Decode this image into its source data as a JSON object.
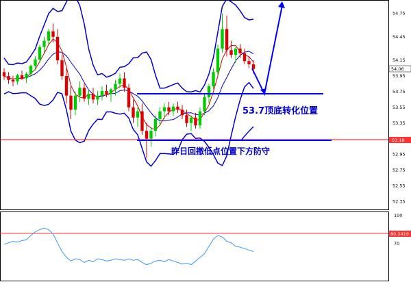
{
  "price_axis": {
    "ticks": [
      "54.75",
      "54.45",
      "54.15",
      "53.95",
      "53.75",
      "53.55",
      "53.35",
      "53.15",
      "52.95",
      "52.75",
      "52.55",
      "52.35"
    ],
    "current_label": "54.06",
    "level_label": "53.18",
    "ylim": [
      52.3,
      54.85
    ]
  },
  "indicator_axis": {
    "ticks": [
      "100",
      "70"
    ],
    "level_label": "80.2419",
    "ylim": [
      10,
      100
    ]
  },
  "annotations": {
    "level_text": "53.7顶底转化位置",
    "defense_text": "昨日回撤低点位置下方防守"
  },
  "colors": {
    "bull": "#00cc00",
    "bear": "#dd0000",
    "band": "#0000cc",
    "annotation": "#0000ff",
    "level_line": "#ff0000",
    "indicator": "#3399ff"
  },
  "chart_data": {
    "type": "candlestick",
    "series": {
      "ohlc": [
        [
          54.0,
          54.05,
          53.9,
          53.95
        ],
        [
          53.95,
          54.0,
          53.85,
          53.9
        ],
        [
          53.9,
          53.95,
          53.82,
          53.88
        ],
        [
          53.88,
          53.98,
          53.84,
          53.96
        ],
        [
          53.96,
          54.02,
          53.9,
          53.92
        ],
        [
          53.92,
          54.0,
          53.86,
          53.98
        ],
        [
          53.98,
          54.1,
          53.94,
          54.08
        ],
        [
          54.08,
          54.2,
          54.02,
          54.16
        ],
        [
          54.16,
          54.35,
          54.12,
          54.32
        ],
        [
          54.32,
          54.45,
          54.25,
          54.4
        ],
        [
          54.4,
          54.55,
          54.35,
          54.52
        ],
        [
          54.52,
          54.62,
          54.38,
          54.45
        ],
        [
          54.45,
          54.55,
          54.1,
          54.15
        ],
        [
          54.15,
          54.22,
          53.9,
          53.95
        ],
        [
          53.95,
          54.05,
          53.6,
          53.7
        ],
        [
          53.7,
          53.82,
          53.4,
          53.52
        ],
        [
          53.52,
          53.75,
          53.45,
          53.7
        ],
        [
          53.7,
          53.88,
          53.62,
          53.8
        ],
        [
          53.8,
          53.85,
          53.62,
          53.66
        ],
        [
          53.66,
          53.78,
          53.58,
          53.72
        ],
        [
          53.72,
          53.8,
          53.6,
          53.65
        ],
        [
          53.65,
          53.76,
          53.58,
          53.7
        ],
        [
          53.7,
          53.82,
          53.64,
          53.76
        ],
        [
          53.76,
          53.84,
          53.68,
          53.72
        ],
        [
          53.72,
          53.8,
          53.62,
          53.78
        ],
        [
          53.78,
          53.9,
          53.7,
          53.85
        ],
        [
          53.85,
          53.98,
          53.8,
          53.92
        ],
        [
          53.92,
          54.0,
          53.75,
          53.8
        ],
        [
          53.8,
          53.85,
          53.5,
          53.55
        ],
        [
          53.55,
          53.65,
          53.35,
          53.42
        ],
        [
          53.42,
          53.55,
          53.3,
          53.5
        ],
        [
          53.5,
          53.6,
          53.2,
          53.25
        ],
        [
          53.25,
          53.35,
          52.9,
          53.15
        ],
        [
          53.15,
          53.3,
          53.05,
          53.25
        ],
        [
          53.25,
          53.45,
          53.18,
          53.4
        ],
        [
          53.4,
          53.55,
          53.32,
          53.5
        ],
        [
          53.5,
          53.6,
          53.4,
          53.55
        ],
        [
          53.55,
          53.62,
          53.45,
          53.5
        ],
        [
          53.5,
          53.6,
          53.44,
          53.56
        ],
        [
          53.56,
          53.62,
          53.48,
          53.52
        ],
        [
          53.52,
          53.58,
          53.4,
          53.45
        ],
        [
          53.45,
          53.52,
          53.3,
          53.35
        ],
        [
          53.35,
          53.45,
          53.25,
          53.42
        ],
        [
          53.42,
          53.48,
          53.28,
          53.32
        ],
        [
          53.32,
          53.55,
          53.28,
          53.5
        ],
        [
          53.5,
          53.72,
          53.45,
          53.68
        ],
        [
          53.68,
          53.85,
          53.6,
          53.82
        ],
        [
          53.82,
          54.05,
          53.78,
          54.0
        ],
        [
          54.0,
          54.35,
          53.95,
          54.3
        ],
        [
          54.3,
          54.75,
          54.25,
          54.55
        ],
        [
          54.55,
          54.72,
          54.2,
          54.28
        ],
        [
          54.28,
          54.4,
          54.18,
          54.22
        ],
        [
          54.22,
          54.32,
          54.12,
          54.3
        ],
        [
          54.3,
          54.36,
          54.18,
          54.24
        ],
        [
          54.24,
          54.3,
          54.1,
          54.14
        ],
        [
          54.14,
          54.2,
          54.05,
          54.1
        ],
        [
          54.1,
          54.15,
          53.98,
          54.04
        ]
      ]
    },
    "bollinger": "upper / middle / lower bands",
    "indicator_values": [
      58,
      60,
      62,
      61,
      63,
      64,
      70,
      75,
      78,
      80,
      78,
      72,
      60,
      48,
      40,
      35,
      38,
      37,
      33,
      36,
      34,
      38,
      37,
      35,
      36,
      38,
      37,
      36,
      38,
      36,
      37,
      33,
      30,
      32,
      35,
      36,
      34,
      37,
      35,
      33,
      31,
      32,
      30,
      35,
      40,
      45,
      55,
      65,
      70,
      68,
      62,
      60,
      55,
      54,
      52,
      50,
      48
    ],
    "arrow_path": "down to 53.7 then up to 54.85"
  }
}
